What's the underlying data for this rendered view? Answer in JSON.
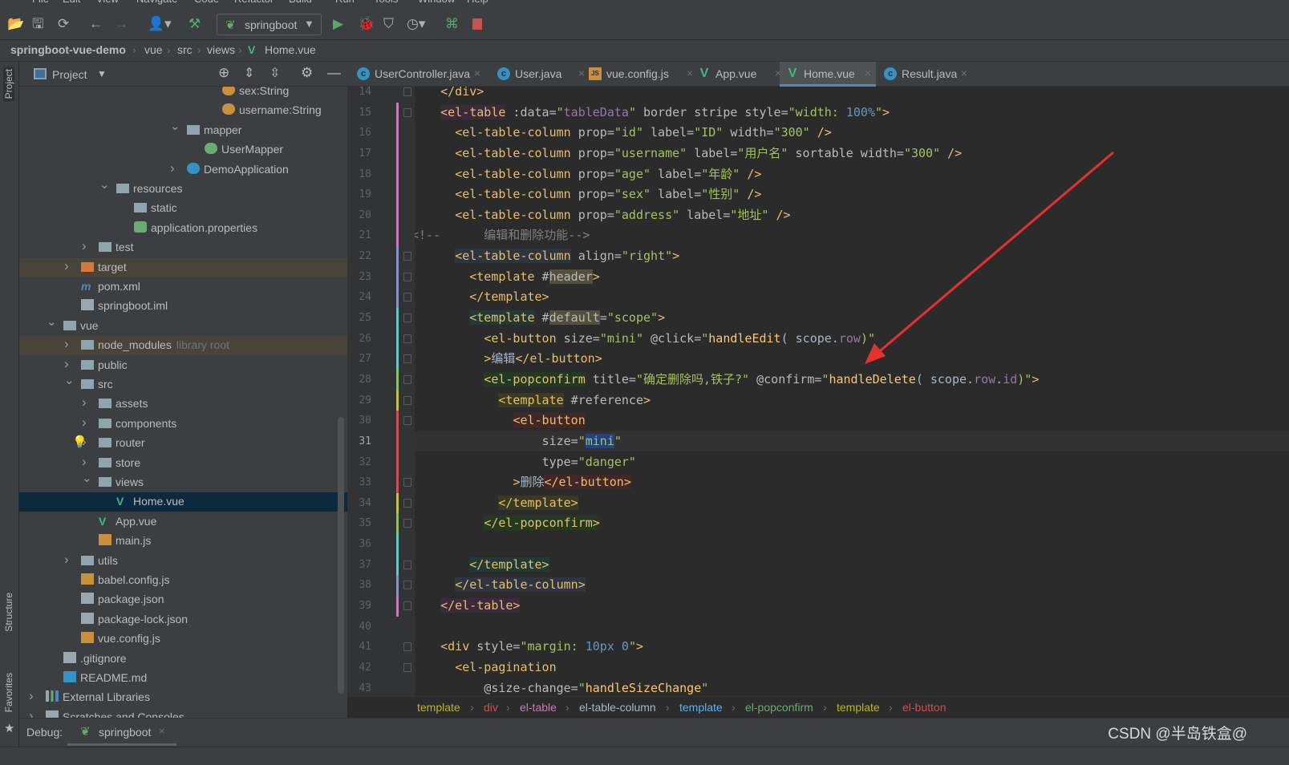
{
  "menu": [
    "File",
    "Edit",
    "View",
    "Navigate",
    "Code",
    "Refactor",
    "Build",
    "Run",
    "Tools",
    "Window",
    "Help"
  ],
  "toolbar": {
    "run_config": "springboot",
    "buttons": [
      "open-icon",
      "save-icon",
      "sync-icon",
      "back-icon",
      "forward-icon",
      "user-icon",
      "build-hammer-icon",
      "run-icon",
      "debug-icon",
      "coverage-icon",
      "profile-icon",
      "attach-debugger-icon",
      "stop-icon"
    ]
  },
  "breadcrumb": [
    "springboot-vue-demo",
    "vue",
    "src",
    "views",
    "Home.vue"
  ],
  "project_panel": {
    "title": "Project",
    "tree": [
      {
        "label": "sex:String",
        "depth": 10,
        "icon": "field",
        "expanded": null
      },
      {
        "label": "username:String",
        "depth": 10,
        "icon": "field",
        "expanded": null
      },
      {
        "label": "mapper",
        "depth": 8,
        "icon": "folder",
        "expanded": true
      },
      {
        "label": "UserMapper",
        "depth": 9,
        "icon": "interface",
        "expanded": null
      },
      {
        "label": "DemoApplication",
        "depth": 8,
        "icon": "spring-class",
        "expanded": false
      },
      {
        "label": "resources",
        "depth": 4,
        "icon": "folder",
        "expanded": true
      },
      {
        "label": "static",
        "depth": 5,
        "icon": "folder",
        "expanded": null
      },
      {
        "label": "application.properties",
        "depth": 5,
        "icon": "spring-config",
        "expanded": null
      },
      {
        "label": "test",
        "depth": 3,
        "icon": "folder",
        "expanded": false
      },
      {
        "label": "target",
        "depth": 2,
        "icon": "folder-orange",
        "expanded": false,
        "highlight": true
      },
      {
        "label": "pom.xml",
        "depth": 2,
        "icon": "maven",
        "expanded": null
      },
      {
        "label": "springboot.iml",
        "depth": 2,
        "icon": "file",
        "expanded": null
      },
      {
        "label": "vue",
        "depth": 1,
        "icon": "folder",
        "expanded": true
      },
      {
        "label": "node_modules",
        "extra": "library root",
        "depth": 2,
        "icon": "folder",
        "expanded": false,
        "highlight": true
      },
      {
        "label": "public",
        "depth": 2,
        "icon": "folder",
        "expanded": false
      },
      {
        "label": "src",
        "depth": 2,
        "icon": "folder",
        "expanded": true
      },
      {
        "label": "assets",
        "depth": 3,
        "icon": "folder",
        "expanded": false
      },
      {
        "label": "components",
        "depth": 3,
        "icon": "folder",
        "expanded": false
      },
      {
        "label": "router",
        "depth": 3,
        "icon": "folder",
        "expanded": false
      },
      {
        "label": "store",
        "depth": 3,
        "icon": "folder",
        "expanded": false
      },
      {
        "label": "views",
        "depth": 3,
        "icon": "folder",
        "expanded": true
      },
      {
        "label": "Home.vue",
        "depth": 4,
        "icon": "vue",
        "expanded": null,
        "selected": true
      },
      {
        "label": "App.vue",
        "depth": 3,
        "icon": "vue",
        "expanded": null
      },
      {
        "label": "main.js",
        "depth": 3,
        "icon": "js",
        "expanded": null
      },
      {
        "label": "utils",
        "depth": 2,
        "icon": "folder",
        "expanded": false
      },
      {
        "label": "babel.config.js",
        "depth": 2,
        "icon": "js",
        "expanded": null
      },
      {
        "label": "package.json",
        "depth": 2,
        "icon": "json",
        "expanded": null
      },
      {
        "label": "package-lock.json",
        "depth": 2,
        "icon": "json",
        "expanded": null
      },
      {
        "label": "vue.config.js",
        "depth": 2,
        "icon": "js",
        "expanded": null
      },
      {
        "label": ".gitignore",
        "depth": 1,
        "icon": "ignore",
        "expanded": null
      },
      {
        "label": "README.md",
        "depth": 1,
        "icon": "markdown",
        "expanded": null
      },
      {
        "label": "External Libraries",
        "depth": 0,
        "icon": "library",
        "expanded": false
      },
      {
        "label": "Scratches and Consoles",
        "depth": 0,
        "icon": "scratch",
        "expanded": false
      }
    ]
  },
  "side_tabs": {
    "project": "Project",
    "structure": "Structure",
    "favorites": "Favorites"
  },
  "editor_tabs": [
    {
      "label": "UserController.java",
      "icon": "java-class",
      "active": false
    },
    {
      "label": "User.java",
      "icon": "java-class",
      "active": false
    },
    {
      "label": "vue.config.js",
      "icon": "js",
      "active": false
    },
    {
      "label": "App.vue",
      "icon": "vue",
      "active": false
    },
    {
      "label": "Home.vue",
      "icon": "vue",
      "active": true
    },
    {
      "label": "Result.java",
      "icon": "java-class",
      "active": false
    }
  ],
  "editor": {
    "current_line": 31,
    "lines": [
      {
        "n": 14,
        "t": [
          [
            "text",
            "    "
          ],
          [
            "tag",
            "</div>"
          ]
        ]
      },
      {
        "n": 15,
        "t": [
          [
            "text",
            "    "
          ],
          [
            "tag-purple-bg",
            "<el-table"
          ],
          [
            "attr",
            " :data="
          ],
          [
            "str",
            "\""
          ],
          [
            "var",
            "tableData"
          ],
          [
            "str",
            "\""
          ],
          [
            "attr",
            " border stripe style="
          ],
          [
            "str",
            "\"width: "
          ],
          [
            "num",
            "100%"
          ],
          [
            "str",
            "\""
          ],
          [
            "tag",
            ">"
          ]
        ]
      },
      {
        "n": 16,
        "t": [
          [
            "text",
            "      "
          ],
          [
            "tag",
            "<el-table-column"
          ],
          [
            "attr",
            " prop="
          ],
          [
            "str",
            "\"id\""
          ],
          [
            "attr",
            " label="
          ],
          [
            "str",
            "\"ID\""
          ],
          [
            "attr",
            " width="
          ],
          [
            "str",
            "\"300\""
          ],
          [
            "tag",
            " />"
          ]
        ]
      },
      {
        "n": 17,
        "t": [
          [
            "text",
            "      "
          ],
          [
            "tag",
            "<el-table-column"
          ],
          [
            "attr",
            " prop="
          ],
          [
            "str",
            "\"username\""
          ],
          [
            "attr",
            " label="
          ],
          [
            "str",
            "\"用户名\""
          ],
          [
            "attr",
            " sortable width="
          ],
          [
            "str",
            "\"300\""
          ],
          [
            "tag",
            " />"
          ]
        ]
      },
      {
        "n": 18,
        "t": [
          [
            "text",
            "      "
          ],
          [
            "tag",
            "<el-table-column"
          ],
          [
            "attr",
            " prop="
          ],
          [
            "str",
            "\"age\""
          ],
          [
            "attr",
            " label="
          ],
          [
            "str",
            "\"年龄\""
          ],
          [
            "tag",
            " />"
          ]
        ]
      },
      {
        "n": 19,
        "t": [
          [
            "text",
            "      "
          ],
          [
            "tag",
            "<el-table-column"
          ],
          [
            "attr",
            " prop="
          ],
          [
            "str",
            "\"sex\""
          ],
          [
            "attr",
            " label="
          ],
          [
            "str",
            "\"性别\""
          ],
          [
            "tag",
            " />"
          ]
        ]
      },
      {
        "n": 20,
        "t": [
          [
            "text",
            "      "
          ],
          [
            "tag",
            "<el-table-column"
          ],
          [
            "attr",
            " prop="
          ],
          [
            "str",
            "\"address\""
          ],
          [
            "attr",
            " label="
          ],
          [
            "str",
            "\"地址\""
          ],
          [
            "tag",
            " />"
          ]
        ]
      },
      {
        "n": 21,
        "t": [
          [
            "comment",
            "<!--      编辑和删除功能-->"
          ]
        ]
      },
      {
        "n": 22,
        "t": [
          [
            "text",
            "      "
          ],
          [
            "tag-blue-bg",
            "<el-table-column"
          ],
          [
            "attr",
            " align="
          ],
          [
            "str",
            "\"right\""
          ],
          [
            "tag",
            ">"
          ]
        ]
      },
      {
        "n": 23,
        "t": [
          [
            "text",
            "        "
          ],
          [
            "tag",
            "<template"
          ],
          [
            "attr",
            " #"
          ],
          [
            "hl",
            "header"
          ],
          [
            "tag",
            ">"
          ]
        ]
      },
      {
        "n": 24,
        "t": [
          [
            "text",
            "        "
          ],
          [
            "tag",
            "</template>"
          ]
        ]
      },
      {
        "n": 25,
        "t": [
          [
            "text",
            "        "
          ],
          [
            "tag-teal-bg",
            "<template"
          ],
          [
            "attr",
            " #"
          ],
          [
            "hl",
            "default"
          ],
          [
            "attr",
            "="
          ],
          [
            "str",
            "\"scope\""
          ],
          [
            "tag",
            ">"
          ]
        ]
      },
      {
        "n": 26,
        "t": [
          [
            "text",
            "          "
          ],
          [
            "tag",
            "<el-button"
          ],
          [
            "attr",
            " size="
          ],
          [
            "str",
            "\"mini\""
          ],
          [
            "attr",
            " @click="
          ],
          [
            "str",
            "\""
          ],
          [
            "fn",
            "handleEdit"
          ],
          [
            "text",
            "( scope."
          ],
          [
            "var",
            "row"
          ],
          [
            "str",
            ")\""
          ]
        ]
      },
      {
        "n": 27,
        "t": [
          [
            "text",
            "          "
          ],
          [
            "tag",
            ">"
          ],
          [
            "text",
            "编辑"
          ],
          [
            "tag",
            "</el-button>"
          ]
        ]
      },
      {
        "n": 28,
        "t": [
          [
            "text",
            "          "
          ],
          [
            "tag-green-bg",
            "<el-popconfirm"
          ],
          [
            "attr",
            " title="
          ],
          [
            "str",
            "\"确定删除吗,铁子?\""
          ],
          [
            "attr",
            " @confirm="
          ],
          [
            "str",
            "\""
          ],
          [
            "fn",
            "handleDelete"
          ],
          [
            "text",
            "( scope."
          ],
          [
            "var",
            "row"
          ],
          [
            "text",
            "."
          ],
          [
            "var",
            "id"
          ],
          [
            "str",
            ")\""
          ],
          [
            "tag",
            ">"
          ]
        ]
      },
      {
        "n": 29,
        "t": [
          [
            "text",
            "            "
          ],
          [
            "tag-olive-bg",
            "<template"
          ],
          [
            "attr",
            " #reference"
          ],
          [
            "tag",
            ">"
          ]
        ]
      },
      {
        "n": 30,
        "t": [
          [
            "text",
            "              "
          ],
          [
            "tag-red-bg",
            "<el-button"
          ]
        ]
      },
      {
        "n": 31,
        "t": [
          [
            "text",
            "                  "
          ],
          [
            "attr",
            "size="
          ],
          [
            "str",
            "\""
          ],
          [
            "strhl",
            "mini"
          ],
          [
            "str",
            "\""
          ]
        ]
      },
      {
        "n": 32,
        "t": [
          [
            "text",
            "                  "
          ],
          [
            "attr",
            "type="
          ],
          [
            "str",
            "\"danger\""
          ]
        ]
      },
      {
        "n": 33,
        "t": [
          [
            "text",
            "              "
          ],
          [
            "tag",
            ">"
          ],
          [
            "text",
            "删除"
          ],
          [
            "tag-red-bg",
            "</el-button>"
          ]
        ]
      },
      {
        "n": 34,
        "t": [
          [
            "text",
            "            "
          ],
          [
            "tag-olive-bg",
            "</template>"
          ]
        ]
      },
      {
        "n": 35,
        "t": [
          [
            "text",
            "          "
          ],
          [
            "tag-green-bg",
            "</el-popconfirm>"
          ]
        ]
      },
      {
        "n": 36,
        "t": []
      },
      {
        "n": 37,
        "t": [
          [
            "text",
            "        "
          ],
          [
            "tag-teal-bg",
            "</template>"
          ]
        ]
      },
      {
        "n": 38,
        "t": [
          [
            "text",
            "      "
          ],
          [
            "tag-blue-bg",
            "</el-table-column>"
          ]
        ]
      },
      {
        "n": 39,
        "t": [
          [
            "text",
            "    "
          ],
          [
            "tag-purple-bg",
            "</el-table>"
          ]
        ]
      },
      {
        "n": 40,
        "t": []
      },
      {
        "n": 41,
        "t": [
          [
            "text",
            "    "
          ],
          [
            "tag",
            "<div"
          ],
          [
            "attr",
            " style="
          ],
          [
            "str",
            "\"margin: "
          ],
          [
            "num",
            "10px 0"
          ],
          [
            "str",
            "\""
          ],
          [
            "tag",
            ">"
          ]
        ]
      },
      {
        "n": 42,
        "t": [
          [
            "text",
            "      "
          ],
          [
            "tag",
            "<el-pagination"
          ]
        ]
      },
      {
        "n": 43,
        "t": [
          [
            "text",
            "          "
          ],
          [
            "attr",
            "@size-change="
          ],
          [
            "str",
            "\""
          ],
          [
            "fn",
            "handleSizeChange"
          ],
          [
            "str",
            "\""
          ]
        ]
      }
    ]
  },
  "tag_path": [
    {
      "label": "template",
      "color": "#bbb529"
    },
    {
      "label": "div",
      "color": "#c75450"
    },
    {
      "label": "el-table",
      "color": "#c77dbb"
    },
    {
      "label": "el-table-column",
      "color": "#a9b7c6"
    },
    {
      "label": "template",
      "color": "#5fb3e8"
    },
    {
      "label": "el-popconfirm",
      "color": "#6aab73"
    },
    {
      "label": "template",
      "color": "#bbb529"
    },
    {
      "label": "el-button",
      "color": "#c75450"
    }
  ],
  "debug": {
    "label": "Debug:",
    "session": "springboot"
  },
  "watermark": "CSDN @半岛铁盒@",
  "annotation": {
    "type": "arrow",
    "color": "#e8302e"
  }
}
